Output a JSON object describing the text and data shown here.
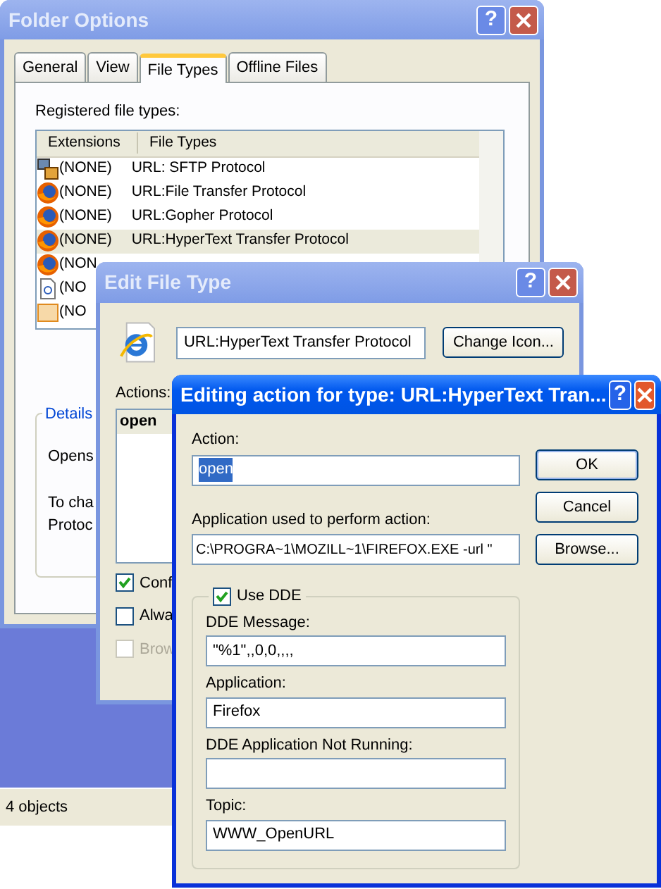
{
  "folder_options": {
    "title": "Folder Options",
    "active": false,
    "help_button": "?",
    "tabs": [
      {
        "label": "General",
        "selected": false
      },
      {
        "label": "View",
        "selected": false
      },
      {
        "label": "File Types",
        "selected": true
      },
      {
        "label": "Offline Files",
        "selected": false
      }
    ],
    "list_label": "Registered file types:",
    "columns": [
      "Extensions",
      "File Types"
    ],
    "rows": [
      {
        "kind": "sftp",
        "extension": "(NONE)",
        "file_type": "URL: SFTP Protocol",
        "selected": false
      },
      {
        "kind": "firefox",
        "extension": "(NONE)",
        "file_type": "URL:File Transfer Protocol",
        "selected": false
      },
      {
        "kind": "firefox",
        "extension": "(NONE)",
        "file_type": "URL:Gopher Protocol",
        "selected": false
      },
      {
        "kind": "firefox",
        "extension": "(NONE)",
        "file_type": "URL:HyperText Transfer Protocol",
        "selected": true
      },
      {
        "kind": "firefox",
        "extension": "(NON",
        "selected": false
      },
      {
        "kind": "document",
        "extension": "(NO",
        "selected": false
      },
      {
        "kind": "package",
        "extension": "(NO",
        "selected": false
      }
    ],
    "details": {
      "legend": "Details",
      "lines": [
        "Opens",
        "To cha",
        "Protoc"
      ]
    }
  },
  "explorer": {
    "status": "4 objects"
  },
  "edit_file_type": {
    "title": "Edit File Type",
    "active": false,
    "help_button": "?",
    "name": "URL:HyperText Transfer Protocol",
    "change_icon": "Change Icon...",
    "actions_label": "Actions:",
    "actions": [
      {
        "label": "open",
        "selected": true
      }
    ],
    "options": [
      {
        "label": "Conf",
        "checked": true,
        "disabled": false
      },
      {
        "label": "Alwa",
        "checked": false,
        "disabled": false
      },
      {
        "label": "Brow",
        "checked": false,
        "disabled": true
      }
    ]
  },
  "editing_action": {
    "title": "Editing action for type: URL:HyperText Tran...",
    "active": true,
    "help_button": "?",
    "action_label": "Action:",
    "action": "open",
    "action_text_selected": true,
    "app_label": "Application used to perform action:",
    "app": "C:\\PROGRA~1\\MOZILL~1\\FIREFOX.EXE -url \"",
    "buttons": [
      "OK",
      "Cancel",
      "Browse..."
    ],
    "use_dde": {
      "label": "Use DDE",
      "checked": true
    },
    "dde_fields": [
      {
        "label": "DDE Message:",
        "value": "\"%1\",,0,0,,,,"
      },
      {
        "label": "Application:",
        "value": "Firefox"
      },
      {
        "label": "DDE Application Not Running:"
      },
      {
        "label": "Topic:",
        "value": "WWW_OpenURL"
      }
    ]
  }
}
